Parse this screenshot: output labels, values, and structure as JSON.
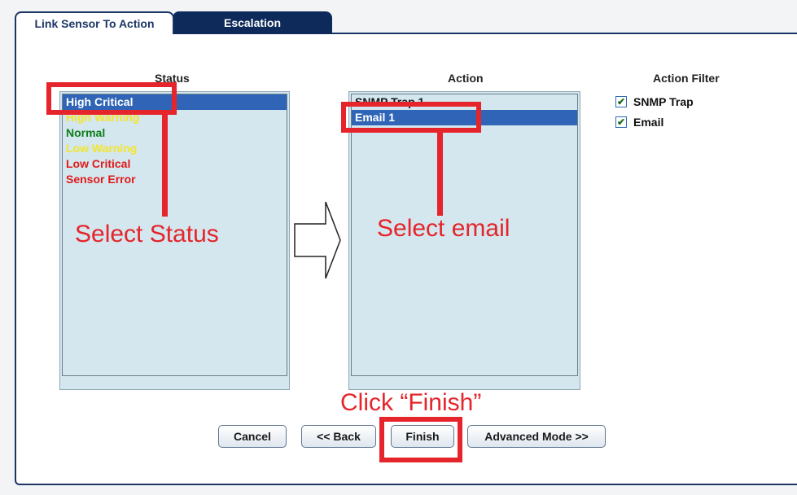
{
  "tabs": [
    {
      "label": "Link Sensor To Action",
      "active": true
    },
    {
      "label": "Escalation",
      "active": false
    }
  ],
  "status": {
    "title": "Status",
    "items": [
      {
        "label": "High Critical",
        "color": "#ffffff",
        "selected": true
      },
      {
        "label": "High Warning",
        "color": "#f3e62a",
        "selected": false
      },
      {
        "label": "Normal",
        "color": "#0e7f18",
        "selected": false
      },
      {
        "label": "Low Warning",
        "color": "#f3e62a",
        "selected": false
      },
      {
        "label": "Low Critical",
        "color": "#e11a1a",
        "selected": false
      },
      {
        "label": "Sensor Error",
        "color": "#e11a1a",
        "selected": false
      }
    ]
  },
  "action": {
    "title": "Action",
    "items": [
      {
        "label": "SNMP Trap 1",
        "selected": false
      },
      {
        "label": "Email 1",
        "selected": true
      }
    ]
  },
  "action_filter": {
    "title": "Action Filter",
    "options": [
      {
        "label": "SNMP Trap",
        "checked": true
      },
      {
        "label": "Email",
        "checked": true
      }
    ]
  },
  "buttons": {
    "cancel": "Cancel",
    "back": "<< Back",
    "finish": "Finish",
    "advanced": "Advanced Mode >>"
  },
  "annotations": {
    "select_status": "Select Status",
    "select_email": "Select email",
    "click_finish": "Click “Finish”"
  },
  "colors": {
    "accent": "#2f64b6",
    "annotation": "#e5242b",
    "tab_dark": "#0d2a5a"
  }
}
